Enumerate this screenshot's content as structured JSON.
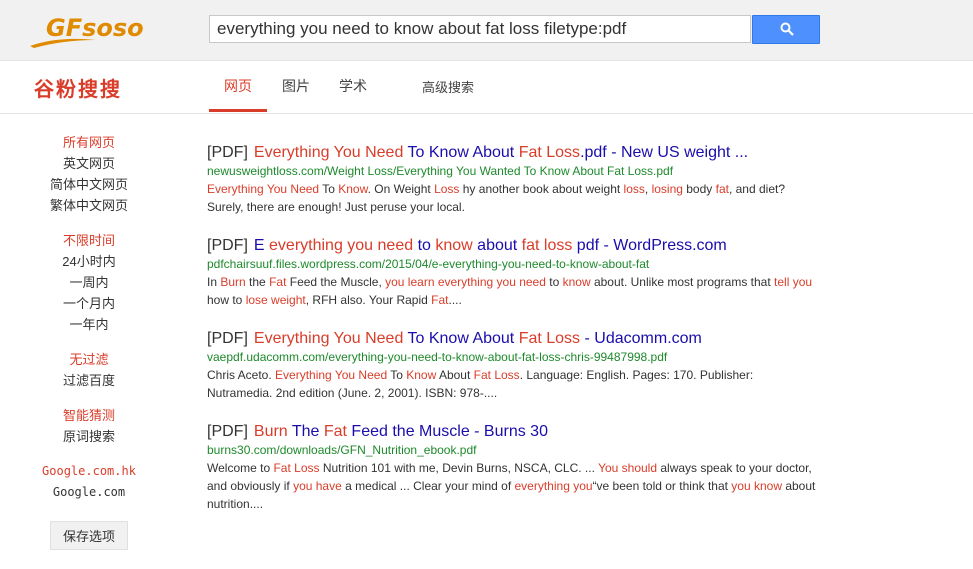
{
  "header": {
    "logo": "GFsoso",
    "query": "everything you need to know about fat loss filetype:pdf",
    "colors": {
      "bar_bg": "#f1f1f1",
      "button": "#4d90fe",
      "accent": "#d93d2a",
      "url": "#1d8a2b",
      "link": "#1a0dab"
    }
  },
  "nav": {
    "brand": "谷粉搜搜",
    "tabs": [
      {
        "label": "网页",
        "active": true
      },
      {
        "label": "图片",
        "active": false
      },
      {
        "label": "学术",
        "active": false
      },
      {
        "label": "高级搜索",
        "active": false
      }
    ]
  },
  "sidebar": {
    "lang": [
      "所有网页",
      "英文网页",
      "简体中文网页",
      "繁体中文网页"
    ],
    "time": [
      "不限时间",
      "24小时内",
      "一周内",
      "一个月内",
      "一年内"
    ],
    "filter": [
      "无过滤",
      "过滤百度"
    ],
    "smart": [
      "智能猜测",
      "原词搜索"
    ],
    "domains": [
      "Google.com.hk",
      "Google.com"
    ],
    "save": "保存选项"
  },
  "results": [
    {
      "tag": "[PDF]",
      "title_parts": [
        {
          "t": "Everything You Need",
          "hl": true
        },
        {
          "t": " To Know ",
          "hl": false
        },
        {
          "t": "About",
          "hl": false
        },
        {
          "t": " Fat Loss",
          "hl": true
        },
        {
          "t": ".pdf - New US weight ...",
          "hl": false
        }
      ],
      "url": "newusweightloss.com/Weight Loss/Everything You Wanted To Know About Fat Loss.pdf",
      "snippet_parts": [
        {
          "t": "Everything You Need",
          "hl": true
        },
        {
          "t": " To ",
          "hl": false
        },
        {
          "t": "Know",
          "hl": true
        },
        {
          "t": ". On Weight ",
          "hl": false
        },
        {
          "t": "Loss",
          "hl": true
        },
        {
          "t": " hy another book about weight ",
          "hl": false
        },
        {
          "t": "loss",
          "hl": true
        },
        {
          "t": ", ",
          "hl": false
        },
        {
          "t": "losing",
          "hl": true
        },
        {
          "t": " body ",
          "hl": false
        },
        {
          "t": "fat",
          "hl": true
        },
        {
          "t": ", and diet? Surely, there are enough! Just peruse your local.",
          "hl": false
        }
      ]
    },
    {
      "tag": "[PDF]",
      "title_parts": [
        {
          "t": "E ",
          "hl": false
        },
        {
          "t": "everything you need",
          "hl": true
        },
        {
          "t": " to ",
          "hl": false
        },
        {
          "t": "know",
          "hl": true
        },
        {
          "t": " about ",
          "hl": false
        },
        {
          "t": "fat loss",
          "hl": true
        },
        {
          "t": " pdf - WordPress.com",
          "hl": false
        }
      ],
      "url": "pdfchairsuuf.files.wordpress.com/2015/04/e-everything-you-need-to-know-about-fat",
      "snippet_parts": [
        {
          "t": "In ",
          "hl": false
        },
        {
          "t": "Burn",
          "hl": true
        },
        {
          "t": " the ",
          "hl": false
        },
        {
          "t": "Fat",
          "hl": true
        },
        {
          "t": " Feed the Muscle, ",
          "hl": false
        },
        {
          "t": "you learn everything you need",
          "hl": true
        },
        {
          "t": " to ",
          "hl": false
        },
        {
          "t": "know",
          "hl": true
        },
        {
          "t": " about. Unlike most programs that ",
          "hl": false
        },
        {
          "t": "tell you",
          "hl": true
        },
        {
          "t": " how to ",
          "hl": false
        },
        {
          "t": "lose weight",
          "hl": true
        },
        {
          "t": ", RFH also. Your Rapid ",
          "hl": false
        },
        {
          "t": "Fat",
          "hl": true
        },
        {
          "t": "....",
          "hl": false
        }
      ]
    },
    {
      "tag": "[PDF]",
      "title_parts": [
        {
          "t": "Everything You Need",
          "hl": true
        },
        {
          "t": " To Know ",
          "hl": false
        },
        {
          "t": "About",
          "hl": false
        },
        {
          "t": " Fat Loss",
          "hl": true
        },
        {
          "t": " - Udacomm.com",
          "hl": false
        }
      ],
      "url": "vaepdf.udacomm.com/everything-you-need-to-know-about-fat-loss-chris-99487998.pdf",
      "snippet_parts": [
        {
          "t": "Chris Aceto. ",
          "hl": false
        },
        {
          "t": "Everything You Need",
          "hl": true
        },
        {
          "t": " To ",
          "hl": false
        },
        {
          "t": "Know",
          "hl": true
        },
        {
          "t": " About ",
          "hl": false
        },
        {
          "t": "Fat Loss",
          "hl": true
        },
        {
          "t": ". Language: English. Pages: 170. Publisher: Nutramedia. 2nd edition (June. 2, 2001). ISBN: 978-....",
          "hl": false
        }
      ]
    },
    {
      "tag": "[PDF]",
      "title_parts": [
        {
          "t": "Burn",
          "hl": true
        },
        {
          "t": " The ",
          "hl": false
        },
        {
          "t": "Fat",
          "hl": true
        },
        {
          "t": " Feed the Muscle - Burns 30",
          "hl": false
        }
      ],
      "url": "burns30.com/downloads/GFN_Nutrition_ebook.pdf",
      "snippet_parts": [
        {
          "t": "Welcome to ",
          "hl": false
        },
        {
          "t": "Fat Loss",
          "hl": true
        },
        {
          "t": " Nutrition 101 with me, Devin Burns, NSCA, CLC. ... ",
          "hl": false
        },
        {
          "t": "You should",
          "hl": true
        },
        {
          "t": " always speak to your doctor, and obviously if ",
          "hl": false
        },
        {
          "t": "you have",
          "hl": true
        },
        {
          "t": " a medical ... Clear your mind of ",
          "hl": false
        },
        {
          "t": "everything you",
          "hl": true
        },
        {
          "t": "“ve been told or think that ",
          "hl": false
        },
        {
          "t": "you know",
          "hl": true
        },
        {
          "t": " about nutrition....",
          "hl": false
        }
      ]
    }
  ]
}
